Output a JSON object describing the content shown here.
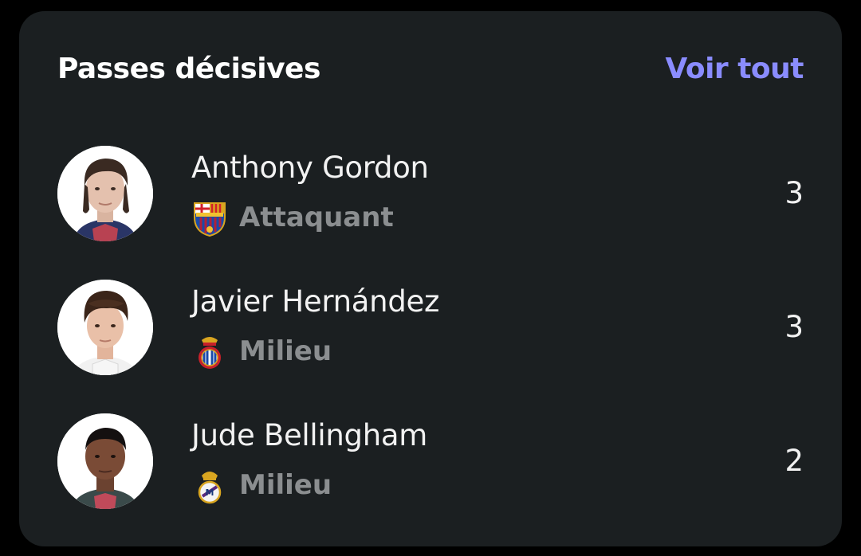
{
  "header": {
    "title": "Passes décisives",
    "see_all_label": "Voir tout"
  },
  "colors": {
    "background": "#000000",
    "card": "#1b1f21",
    "accent": "#8a8cff",
    "muted": "#8b8e90"
  },
  "players": [
    {
      "name": "Anthony Gordon",
      "position": "Attaquant",
      "club_icon": "fc-barcelona-crest-icon",
      "value": "3"
    },
    {
      "name": "Javier Hernández",
      "position": "Milieu",
      "club_icon": "rcd-espanyol-crest-icon",
      "value": "3"
    },
    {
      "name": "Jude Bellingham",
      "position": "Milieu",
      "club_icon": "real-madrid-crest-icon",
      "value": "2"
    }
  ]
}
